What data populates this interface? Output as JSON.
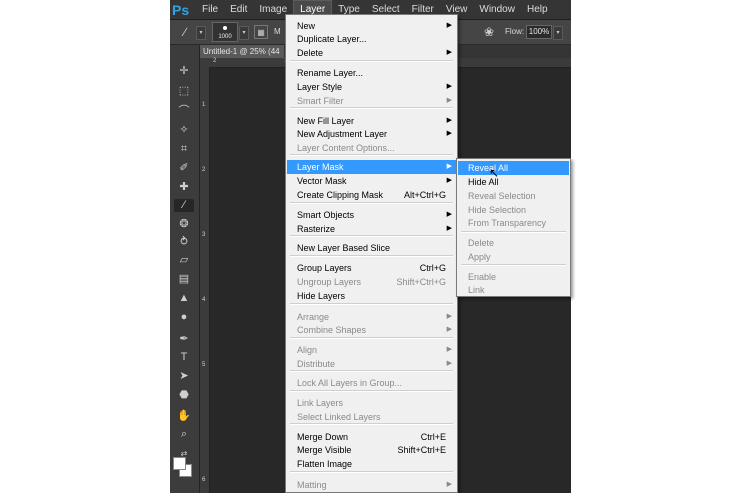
{
  "app": {
    "logo": "Ps",
    "menus": [
      "File",
      "Edit",
      "Image",
      "Layer",
      "Type",
      "Select",
      "Filter",
      "View",
      "Window",
      "Help"
    ],
    "active_menu": "Layer"
  },
  "options_bar": {
    "brush_size": "1000",
    "mode_label": "M",
    "flow_label": "Flow:",
    "flow_value": "100%"
  },
  "document": {
    "tab_title": "Untitled-1 @ 25% (44"
  },
  "rulers": {
    "top": [
      "2",
      "1"
    ],
    "left": [
      "1",
      "2",
      "3",
      "4",
      "5",
      "6"
    ]
  },
  "layer_menu": {
    "items": [
      {
        "label": "New",
        "shortcut": "",
        "submenu": true,
        "disabled": false,
        "highlighted": false
      },
      {
        "label": "Duplicate Layer...",
        "shortcut": "",
        "submenu": false,
        "disabled": false,
        "highlighted": false
      },
      {
        "label": "Delete",
        "shortcut": "",
        "submenu": true,
        "disabled": false,
        "highlighted": false
      },
      {
        "label": "Rename Layer...",
        "shortcut": "",
        "submenu": false,
        "disabled": false,
        "highlighted": false
      },
      {
        "label": "Layer Style",
        "shortcut": "",
        "submenu": true,
        "disabled": false,
        "highlighted": false
      },
      {
        "label": "Smart Filter",
        "shortcut": "",
        "submenu": true,
        "disabled": true,
        "highlighted": false
      },
      {
        "label": "New Fill Layer",
        "shortcut": "",
        "submenu": true,
        "disabled": false,
        "highlighted": false
      },
      {
        "label": "New Adjustment Layer",
        "shortcut": "",
        "submenu": true,
        "disabled": false,
        "highlighted": false
      },
      {
        "label": "Layer Content Options...",
        "shortcut": "",
        "submenu": false,
        "disabled": true,
        "highlighted": false
      },
      {
        "label": "Layer Mask",
        "shortcut": "",
        "submenu": true,
        "disabled": false,
        "highlighted": true
      },
      {
        "label": "Vector Mask",
        "shortcut": "",
        "submenu": true,
        "disabled": false,
        "highlighted": false
      },
      {
        "label": "Create Clipping Mask",
        "shortcut": "Alt+Ctrl+G",
        "submenu": false,
        "disabled": false,
        "highlighted": false
      },
      {
        "label": "Smart Objects",
        "shortcut": "",
        "submenu": true,
        "disabled": false,
        "highlighted": false
      },
      {
        "label": "Rasterize",
        "shortcut": "",
        "submenu": true,
        "disabled": false,
        "highlighted": false
      },
      {
        "label": "New Layer Based Slice",
        "shortcut": "",
        "submenu": false,
        "disabled": false,
        "highlighted": false
      },
      {
        "label": "Group Layers",
        "shortcut": "Ctrl+G",
        "submenu": false,
        "disabled": false,
        "highlighted": false
      },
      {
        "label": "Ungroup Layers",
        "shortcut": "Shift+Ctrl+G",
        "submenu": false,
        "disabled": true,
        "highlighted": false
      },
      {
        "label": "Hide Layers",
        "shortcut": "",
        "submenu": false,
        "disabled": false,
        "highlighted": false
      },
      {
        "label": "Arrange",
        "shortcut": "",
        "submenu": true,
        "disabled": true,
        "highlighted": false
      },
      {
        "label": "Combine Shapes",
        "shortcut": "",
        "submenu": true,
        "disabled": true,
        "highlighted": false
      },
      {
        "label": "Align",
        "shortcut": "",
        "submenu": true,
        "disabled": true,
        "highlighted": false
      },
      {
        "label": "Distribute",
        "shortcut": "",
        "submenu": true,
        "disabled": true,
        "highlighted": false
      },
      {
        "label": "Lock All Layers in Group...",
        "shortcut": "",
        "submenu": false,
        "disabled": true,
        "highlighted": false
      },
      {
        "label": "Link Layers",
        "shortcut": "",
        "submenu": false,
        "disabled": true,
        "highlighted": false
      },
      {
        "label": "Select Linked Layers",
        "shortcut": "",
        "submenu": false,
        "disabled": true,
        "highlighted": false
      },
      {
        "label": "Merge Down",
        "shortcut": "Ctrl+E",
        "submenu": false,
        "disabled": false,
        "highlighted": false
      },
      {
        "label": "Merge Visible",
        "shortcut": "Shift+Ctrl+E",
        "submenu": false,
        "disabled": false,
        "highlighted": false
      },
      {
        "label": "Flatten Image",
        "shortcut": "",
        "submenu": false,
        "disabled": false,
        "highlighted": false
      },
      {
        "label": "Matting",
        "shortcut": "",
        "submenu": true,
        "disabled": true,
        "highlighted": false
      }
    ]
  },
  "layer_mask_submenu": {
    "items": [
      {
        "label": "Reveal All",
        "disabled": false,
        "highlighted": true
      },
      {
        "label": "Hide All",
        "disabled": false,
        "highlighted": false
      },
      {
        "label": "Reveal Selection",
        "disabled": true,
        "highlighted": false
      },
      {
        "label": "Hide Selection",
        "disabled": true,
        "highlighted": false
      },
      {
        "label": "From Transparency",
        "disabled": true,
        "highlighted": false
      },
      {
        "label": "Delete",
        "disabled": true,
        "highlighted": false
      },
      {
        "label": "Apply",
        "disabled": true,
        "highlighted": false
      },
      {
        "label": "Enable",
        "disabled": true,
        "highlighted": false
      },
      {
        "label": "Link",
        "disabled": true,
        "highlighted": false
      }
    ]
  },
  "tools": [
    "move-tool",
    "marquee-tool",
    "lasso-tool",
    "quick-select-tool",
    "crop-tool",
    "eyedropper-tool",
    "healing-brush-tool",
    "brush-tool",
    "clone-stamp-tool",
    "history-brush-tool",
    "eraser-tool",
    "gradient-tool",
    "blur-tool",
    "dodge-tool",
    "pen-tool",
    "type-tool",
    "path-select-tool",
    "shape-tool",
    "hand-tool",
    "zoom-tool"
  ],
  "colors": {
    "highlight": "#3399ff",
    "menu_bg": "#f0f0f0",
    "app_dark": "#282828",
    "ps_blue": "#2fa3e6"
  }
}
